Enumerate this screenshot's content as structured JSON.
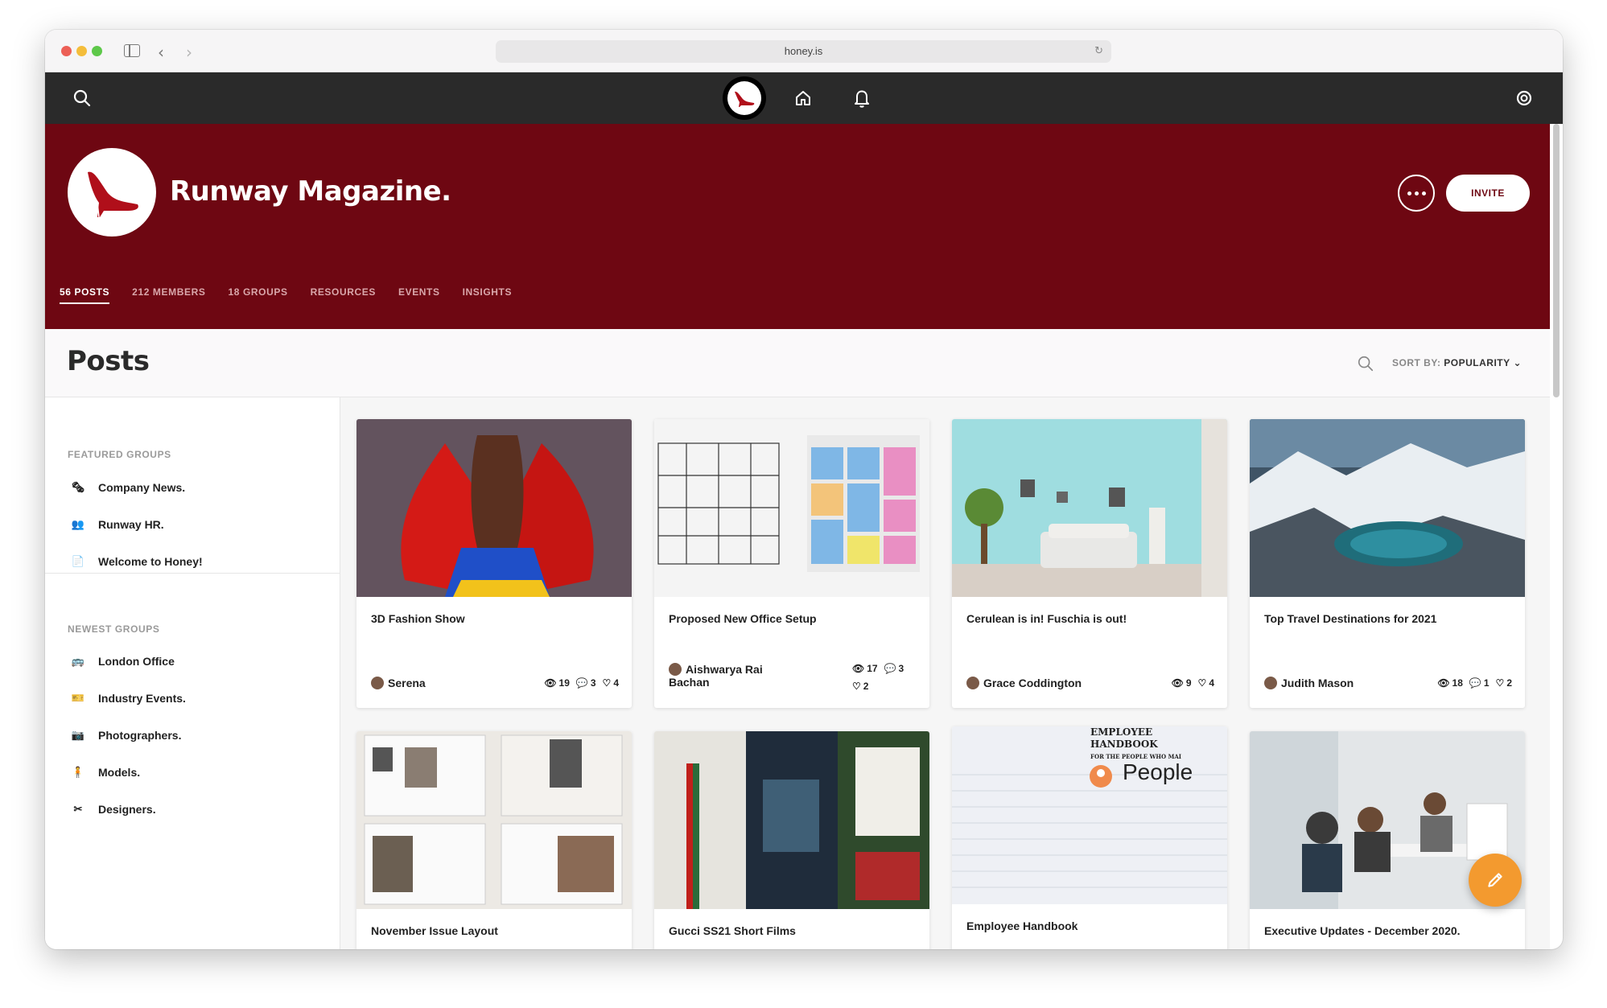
{
  "browser": {
    "url": "honey.is"
  },
  "group": {
    "title": "Runway Magazine.",
    "invite_label": "INVITE",
    "tabs": [
      "56 POSTS",
      "212 MEMBERS",
      "18 GROUPS",
      "RESOURCES",
      "EVENTS",
      "INSIGHTS"
    ]
  },
  "posts": {
    "title": "Posts",
    "sort_label": "SORT BY:",
    "sort_value": "POPULARITY"
  },
  "sidebar": {
    "featured_label": "FEATURED GROUPS",
    "featured": [
      "Company News.",
      "Runway HR.",
      "Welcome to Honey!"
    ],
    "newest_label": "NEWEST GROUPS",
    "newest": [
      "London Office",
      "Industry Events.",
      "Photographers.",
      "Models.",
      "Designers."
    ]
  },
  "cards": [
    {
      "title": "3D Fashion Show",
      "author": "Serena",
      "views": "19",
      "comments": "3",
      "likes": "4"
    },
    {
      "title": "Proposed New Office Setup",
      "author": "Aishwarya Rai",
      "author2": "Bachan",
      "views": "17",
      "comments": "3",
      "likes": "2"
    },
    {
      "title": "Cerulean is in! Fuschia is out!",
      "author": "Grace Coddington",
      "views": "9",
      "likes": "4"
    },
    {
      "title": "Top Travel Destinations for 2021",
      "author": "Judith Mason",
      "views": "18",
      "comments": "1",
      "likes": "2"
    },
    {
      "title": "November Issue Layout"
    },
    {
      "title": "Gucci SS21 Short Films"
    },
    {
      "title": "Employee Handbook",
      "img_text": [
        "EMPLOYEE",
        "HANDBOOK",
        "FOR THE PEOPLE WHO MAI",
        "People"
      ]
    },
    {
      "title": "Executive Updates - December 2020."
    }
  ],
  "colors": {
    "brand": "#6e0712",
    "topbar": "#2a2a2a",
    "fab": "#f39a2f"
  }
}
